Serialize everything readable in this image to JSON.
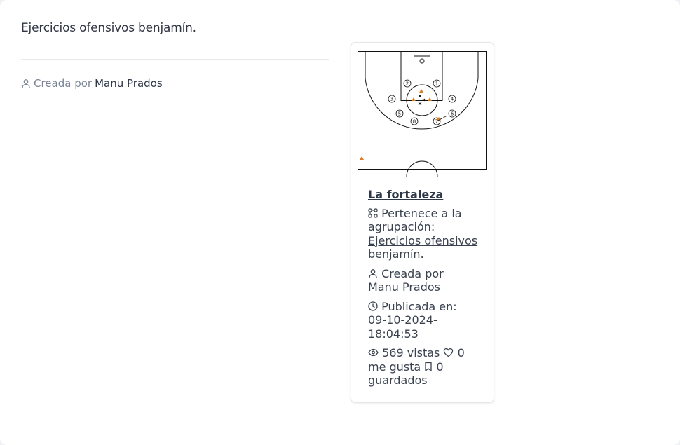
{
  "page": {
    "heading": "Ejercicios ofensivos benjamín.",
    "created_by_label": "Creada por",
    "author": "Manu Prados"
  },
  "card": {
    "title": "La fortaleza",
    "group_label": "Pertenece a la agrupación:",
    "group_link": "Ejercicios ofensivos benjamín.",
    "created_by_label": "Creada por",
    "author": "Manu Prados",
    "published_label": "Publicada en:",
    "published_date": "09-10-2024-",
    "published_time": "18:04:53",
    "views": "569 vistas",
    "likes": "0 me gusta",
    "saved": "0 guardados",
    "players": [
      "1",
      "2",
      "3",
      "4",
      "5",
      "6",
      "7",
      "8"
    ],
    "icons": [
      "user-icon",
      "group-icon",
      "clock-icon",
      "eye-icon",
      "heart-icon",
      "bookmark-icon"
    ]
  }
}
